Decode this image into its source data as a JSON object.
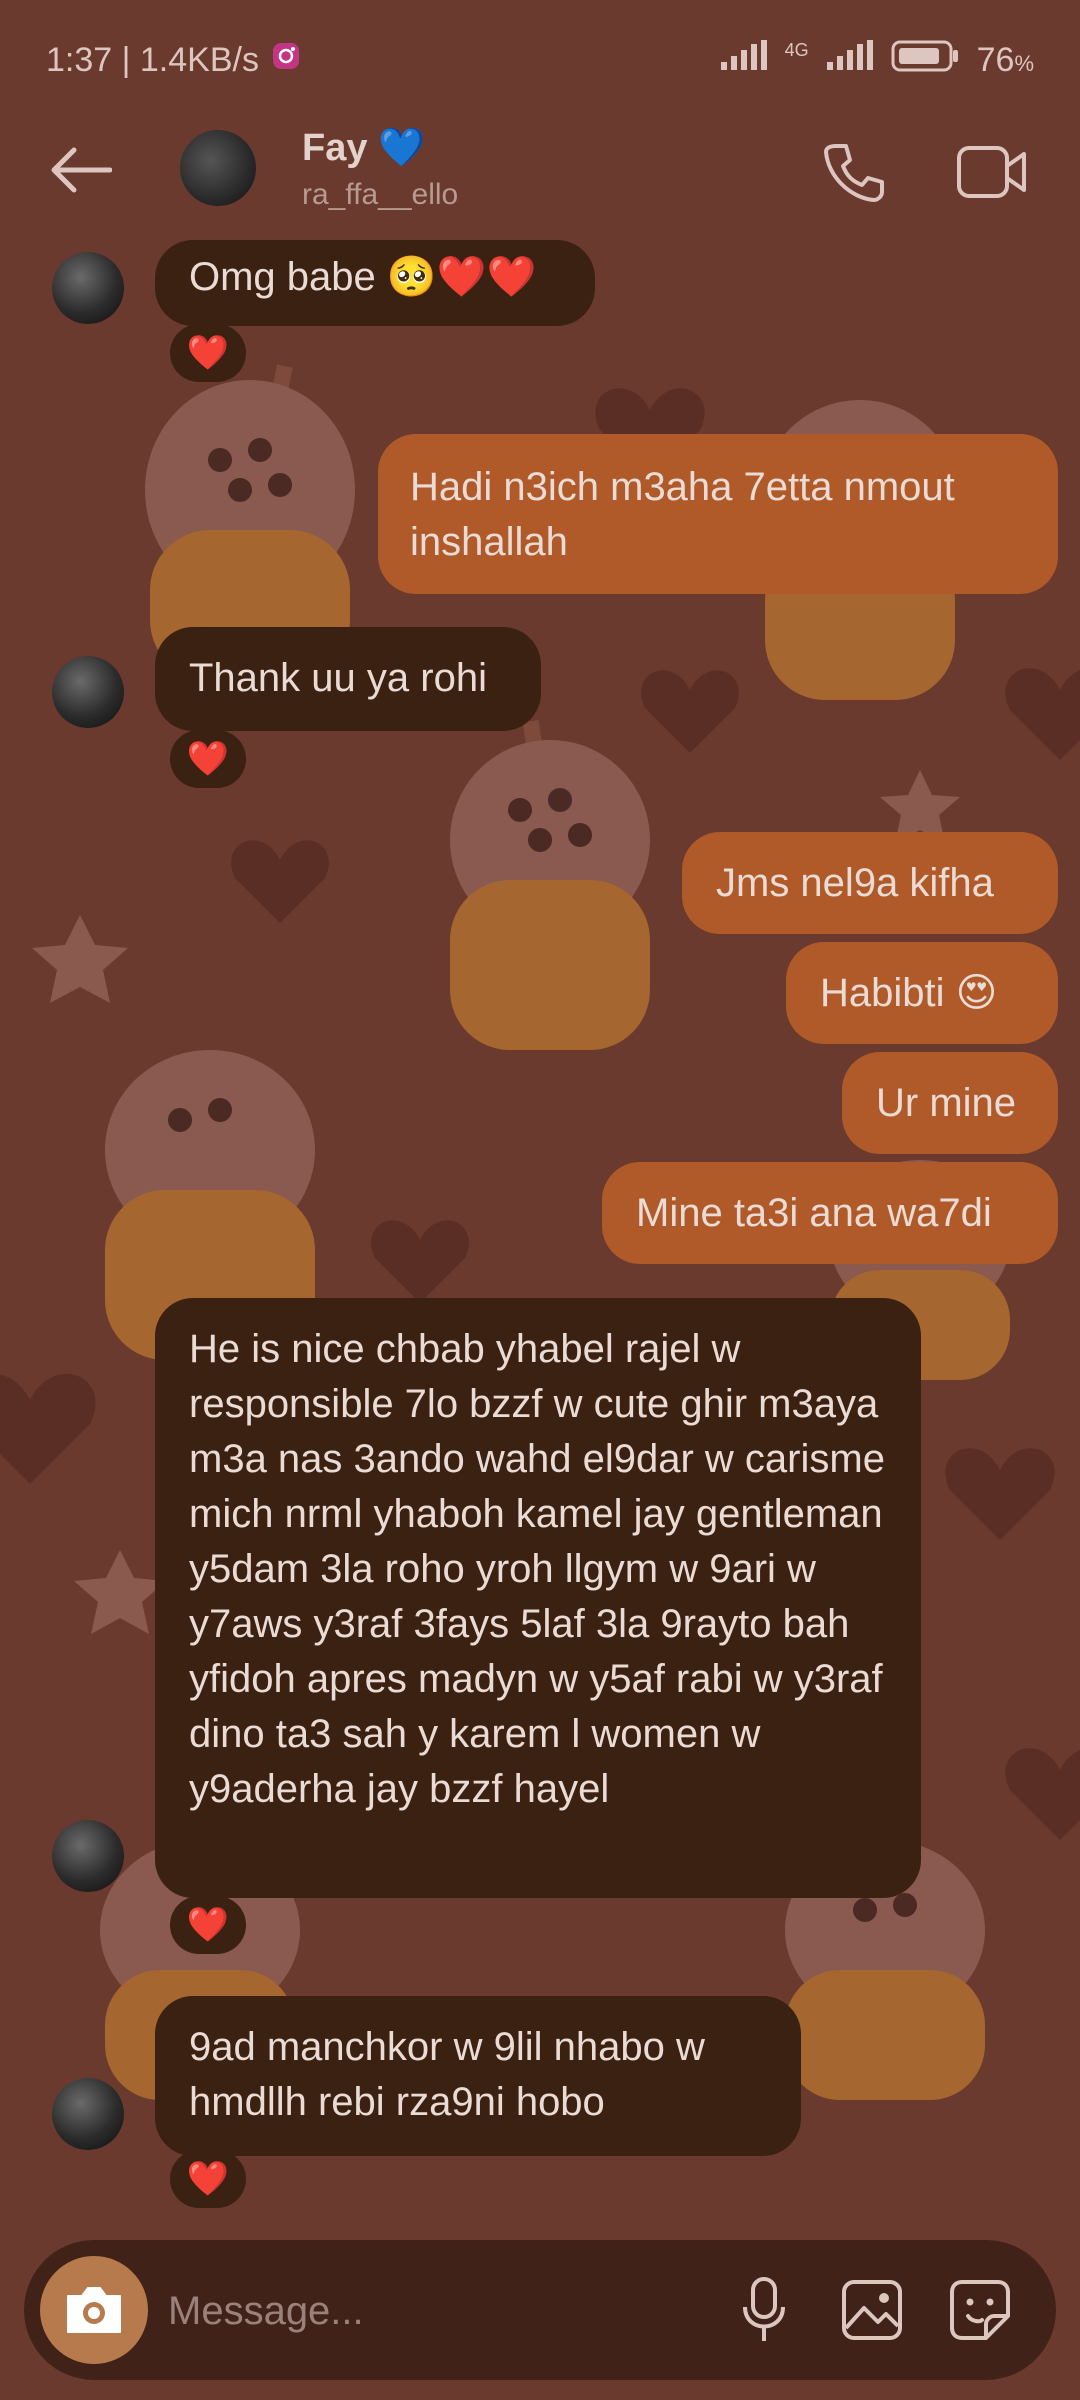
{
  "status_bar": {
    "time_speed": "1:37 | 1.4KB/s",
    "network": "4G",
    "battery": "76"
  },
  "header": {
    "name": "Fay",
    "name_emoji": "💙",
    "username": "ra_ffa__ello"
  },
  "messages": [
    {
      "dir": "in",
      "text": "Omg babe 🥺❤️❤️",
      "reaction": "❤️"
    },
    {
      "dir": "out",
      "text": "Hadi n3ich m3aha 7etta nmout inshallah"
    },
    {
      "dir": "in",
      "text": "Thank uu ya rohi",
      "reaction": "❤️"
    },
    {
      "dir": "out",
      "text": "Jms nel9a kifha"
    },
    {
      "dir": "out",
      "text": "Habibti 😍"
    },
    {
      "dir": "out",
      "text": "Ur mine"
    },
    {
      "dir": "out",
      "text": "Mine ta3i ana wa7di"
    },
    {
      "dir": "in",
      "text": "He is nice chbab yhabel rajel w responsible  7lo bzzf w cute ghir m3aya m3a nas 3ando wahd el9dar w carisme mich nrml yhaboh kamel jay gentleman y5dam 3la roho yroh llgym w 9ari w y7aws y3raf 3fays 5laf 3la 9rayto bah yfidoh apres madyn w y5af rabi w y3raf dino ta3 sah  y karem l women w y9aderha jay bzzf hayel",
      "reaction": "❤️"
    },
    {
      "dir": "in",
      "text": "9ad manchkor w 9lil nhabo w hmdllh rebi rza9ni hobo",
      "reaction": "❤️"
    }
  ],
  "composer": {
    "placeholder": "Message..."
  },
  "icons": {
    "back": "back-arrow-icon",
    "call": "phone-icon",
    "video": "video-camera-icon",
    "camera": "camera-icon",
    "mic": "microphone-icon",
    "gallery": "image-icon",
    "sticker": "sticker-icon"
  },
  "colors": {
    "background": "#6a3a2e",
    "incoming_bubble": "#3b2112",
    "outgoing_bubble": "#b05a2a",
    "reaction_heart": "#e0362f",
    "camera_button": "#b77a4d"
  }
}
